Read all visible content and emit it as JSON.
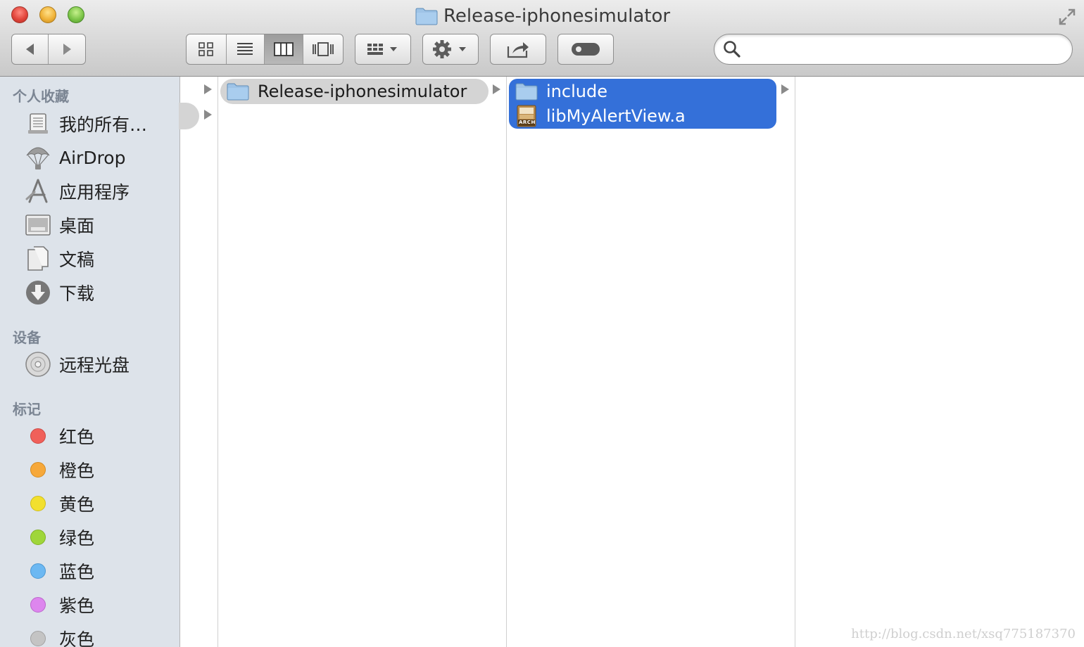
{
  "window": {
    "title": "Release-iphonesimulator"
  },
  "toolbar": {
    "search_placeholder": ""
  },
  "sidebar": {
    "favorites_header": "个人收藏",
    "favorites": [
      {
        "label": "我的所有…",
        "icon": "all-files-icon"
      },
      {
        "label": "AirDrop",
        "icon": "airdrop-icon"
      },
      {
        "label": "应用程序",
        "icon": "applications-icon"
      },
      {
        "label": "桌面",
        "icon": "desktop-icon"
      },
      {
        "label": "文稿",
        "icon": "documents-icon"
      },
      {
        "label": "下载",
        "icon": "downloads-icon"
      }
    ],
    "devices_header": "设备",
    "devices": [
      {
        "label": "远程光盘",
        "icon": "remote-disc-icon"
      }
    ],
    "tags_header": "标记",
    "tags": [
      {
        "label": "红色",
        "color": "#f0605a"
      },
      {
        "label": "橙色",
        "color": "#f6a83a"
      },
      {
        "label": "黄色",
        "color": "#f2e02e"
      },
      {
        "label": "绿色",
        "color": "#9fd63a"
      },
      {
        "label": "蓝色",
        "color": "#6cb8f2"
      },
      {
        "label": "紫色",
        "color": "#dd86ee"
      },
      {
        "label": "灰色",
        "color": "#c4c4c4"
      }
    ]
  },
  "columns": {
    "col2_items": [
      {
        "name": "Release-iphonesimulator",
        "icon": "folder-icon"
      }
    ],
    "col3_items": [
      {
        "name": "include",
        "icon": "folder-icon"
      },
      {
        "name": "libMyAlertView.a",
        "icon": "archive-icon",
        "badge": "ARCH"
      }
    ]
  },
  "watermark": "http://blog.csdn.net/xsq775187370",
  "colors": {
    "selection": "#3470d9",
    "path_highlight": "#d4d4d4"
  }
}
